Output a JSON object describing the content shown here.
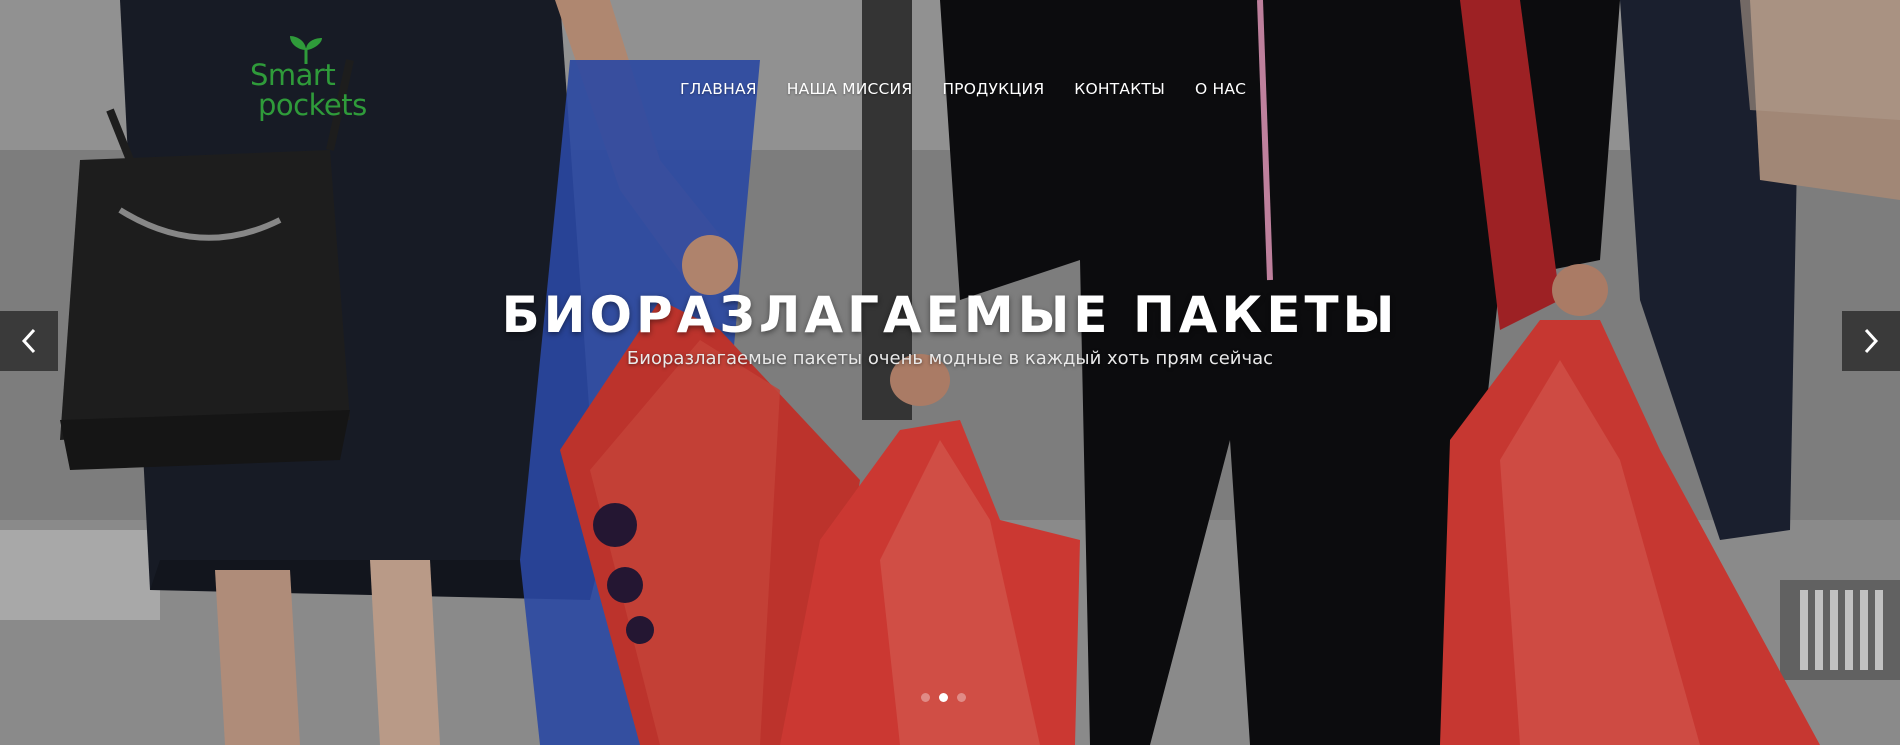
{
  "brand": {
    "line1": "Smart",
    "line2": "pockets",
    "color": "#2f9b3a"
  },
  "nav": {
    "items": [
      {
        "label": "ГЛАВНАЯ"
      },
      {
        "label": "НАША МИССИЯ"
      },
      {
        "label": "ПРОДУКЦИЯ"
      },
      {
        "label": "КОНТАКТЫ"
      },
      {
        "label": "О НАС"
      }
    ]
  },
  "hero": {
    "title": "БИОРАЗЛАГАЕМЫЕ ПАКЕТЫ",
    "subtitle": "Биоразлагаемые пакеты очень модные в каждый хоть прям сейчас"
  },
  "slider": {
    "prev_icon": "chevron-left-icon",
    "next_icon": "chevron-right-icon",
    "slide_count": 3,
    "active_slide": 2
  },
  "colors": {
    "bag_red": "#e8403a",
    "arrow_bg": "#2a2a2a"
  }
}
